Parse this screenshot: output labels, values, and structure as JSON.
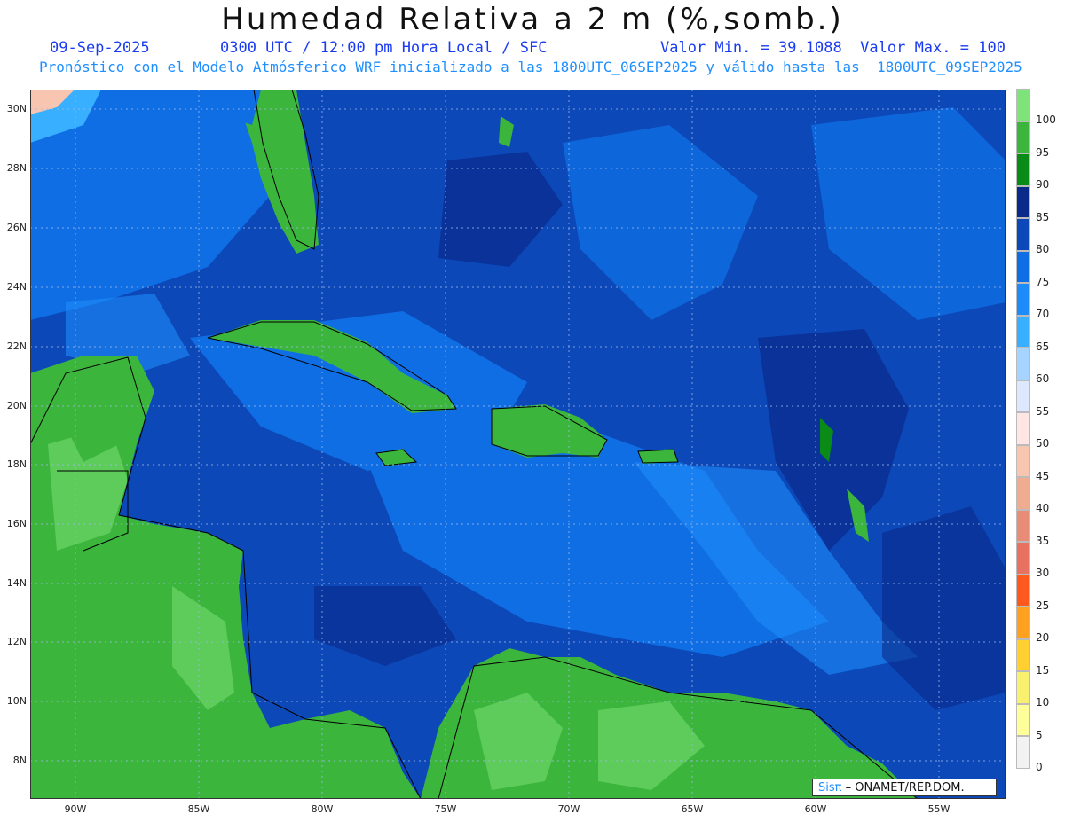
{
  "title": "Humedad Relativa a 2 m (%,somb.)",
  "header": {
    "date": "09-Sep-2025",
    "time": "0300 UTC / 12:00 pm Hora Local / SFC",
    "minmax": "Valor Min. = 39.1088  Valor Max. = 100",
    "forecast": "Pronóstico con el Modelo Atmósferico WRF inicializado a las 1800UTC_06SEP2025 y válido hasta las  1800UTC_09SEP2025"
  },
  "axes": {
    "lat_labels": [
      "30N",
      "28N",
      "26N",
      "24N",
      "22N",
      "20N",
      "18N",
      "16N",
      "14N",
      "12N",
      "10N",
      "8N"
    ],
    "lon_labels": [
      "90W",
      "85W",
      "80W",
      "75W",
      "70W",
      "65W",
      "60W",
      "55W"
    ]
  },
  "legend": {
    "labels": [
      "100",
      "95",
      "90",
      "85",
      "80",
      "75",
      "70",
      "65",
      "60",
      "55",
      "50",
      "45",
      "40",
      "35",
      "30",
      "25",
      "20",
      "15",
      "10",
      "5",
      "0"
    ],
    "colors": [
      "#7ee37a",
      "#3cb53c",
      "#0a8a16",
      "#0a2a8a",
      "#0c48b8",
      "#0f6ee4",
      "#1e8cf8",
      "#38b0ff",
      "#a4d4ff",
      "#dce8ff",
      "#ffe6e2",
      "#f8c6b0",
      "#f0ac90",
      "#e88c78",
      "#e87262",
      "#ff5a1e",
      "#ffa020",
      "#ffd030",
      "#f8f06e",
      "#ffff9a",
      "#f2f2f2"
    ]
  },
  "credit": {
    "brand": "Sisπ",
    "text": "– ONAMET/REP.DOM."
  },
  "colors": {
    "sea": "#0c48b8",
    "land": "#3cb53c",
    "dark_water": "#0a2a8a",
    "light_water": "#1e8cf8"
  }
}
